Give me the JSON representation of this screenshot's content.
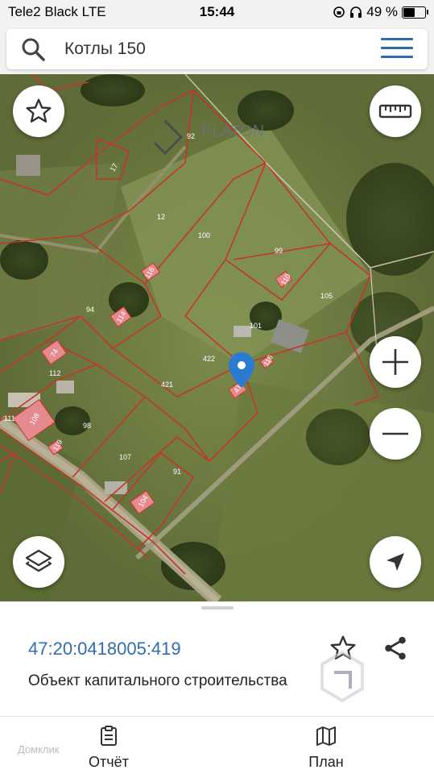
{
  "status_bar": {
    "carrier": "Tele2 Black",
    "network": "LTE",
    "time": "15:44",
    "battery_text": "49 %",
    "battery_level": 0.49
  },
  "search": {
    "query": "Котлы 150",
    "icon": "search-icon",
    "menu_icon": "hamburger-menu-icon"
  },
  "map": {
    "overlay_brand": "PLATON",
    "parcel_numbers": [
      "92",
      "17",
      "12",
      "100",
      "99",
      "105",
      "94",
      "101",
      "422",
      "112",
      "421",
      "111",
      "98",
      "107",
      "91"
    ],
    "building_labels": [
      "116",
      "114",
      "110",
      "419",
      "116",
      "108",
      "119",
      "104",
      "74"
    ],
    "controls": {
      "favorite_icon": "star-icon",
      "ruler_icon": "ruler-icon",
      "zoom_in_icon": "plus-icon",
      "zoom_out_icon": "minus-icon",
      "layers_icon": "layers-icon",
      "location_icon": "navigation-arrow-icon"
    },
    "colors": {
      "boundary": "#c4352b",
      "building": "#e58a8f",
      "marker": "#2b7bd3"
    }
  },
  "details": {
    "cadastral_number": "47:20:0418005:419",
    "object_type": "Объект капитального строительства",
    "favorite_icon": "star-icon",
    "share_icon": "share-icon"
  },
  "bottom_tabs": [
    {
      "label": "Отчёт",
      "icon": "report-icon"
    },
    {
      "label": "План",
      "icon": "map-plan-icon"
    }
  ],
  "watermark": "Домклик"
}
